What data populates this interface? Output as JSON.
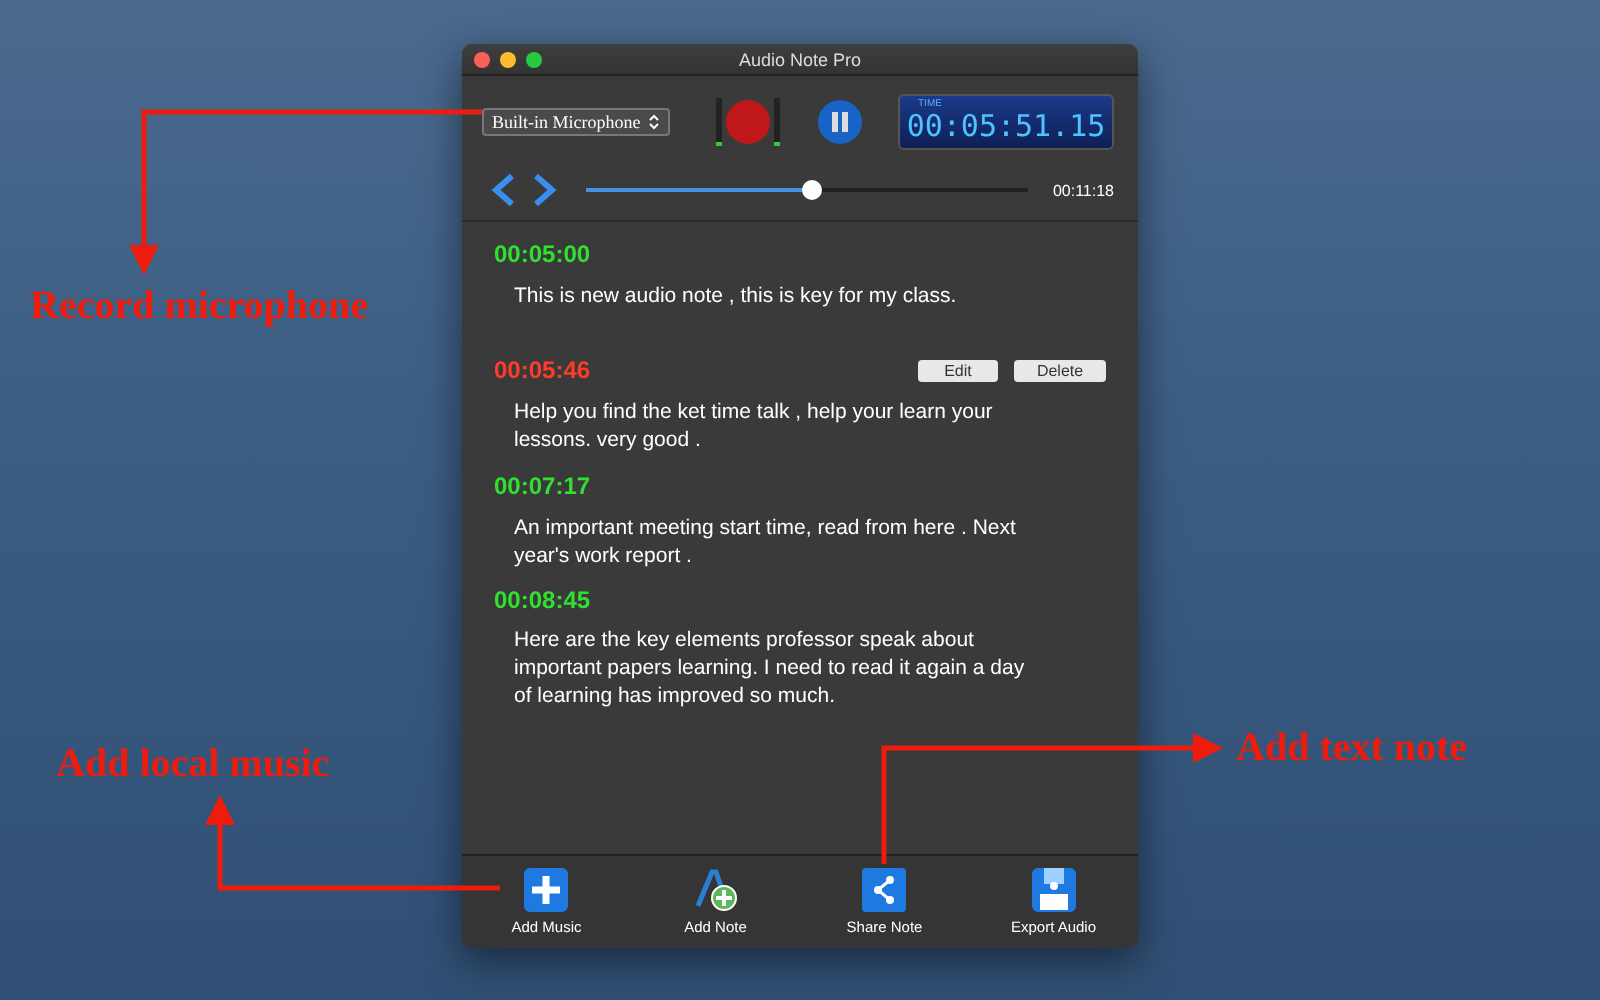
{
  "window": {
    "title": "Audio Note Pro"
  },
  "input_device": {
    "value": "Built-in Microphone"
  },
  "recording": {
    "on": true
  },
  "timer": {
    "label": "TIME",
    "value": "00:05:51.15"
  },
  "playback": {
    "level": 0.51,
    "duration": "00:11:18"
  },
  "notes": [
    {
      "time": "00:05:00",
      "text": "This is new audio note , this is key for my class.",
      "selected": false
    },
    {
      "time": "00:05:46",
      "text": "Help you find the ket time talk , help your learn your lessons. very good .",
      "selected": true,
      "actions": [
        "Edit",
        "Delete"
      ]
    },
    {
      "time": "00:07:17",
      "text": "An important meeting start time, read from here . Next year's work report .",
      "selected": false
    },
    {
      "time": "00:08:45",
      "text": "Here are the key elements professor speak about important papers learning. I need to read it again a day of learning has improved so much.",
      "selected": false
    }
  ],
  "toolbar": [
    {
      "kind": "add-music",
      "label": "Add Music"
    },
    {
      "kind": "add-note",
      "label": "Add Note"
    },
    {
      "kind": "share",
      "label": "Share Note"
    },
    {
      "kind": "export",
      "label": "Export Audio"
    }
  ],
  "annotations": [
    {
      "kind": "record",
      "text": "Record microphone"
    },
    {
      "kind": "music",
      "text": "Add local music"
    },
    {
      "kind": "note",
      "text": "Add text note"
    }
  ]
}
